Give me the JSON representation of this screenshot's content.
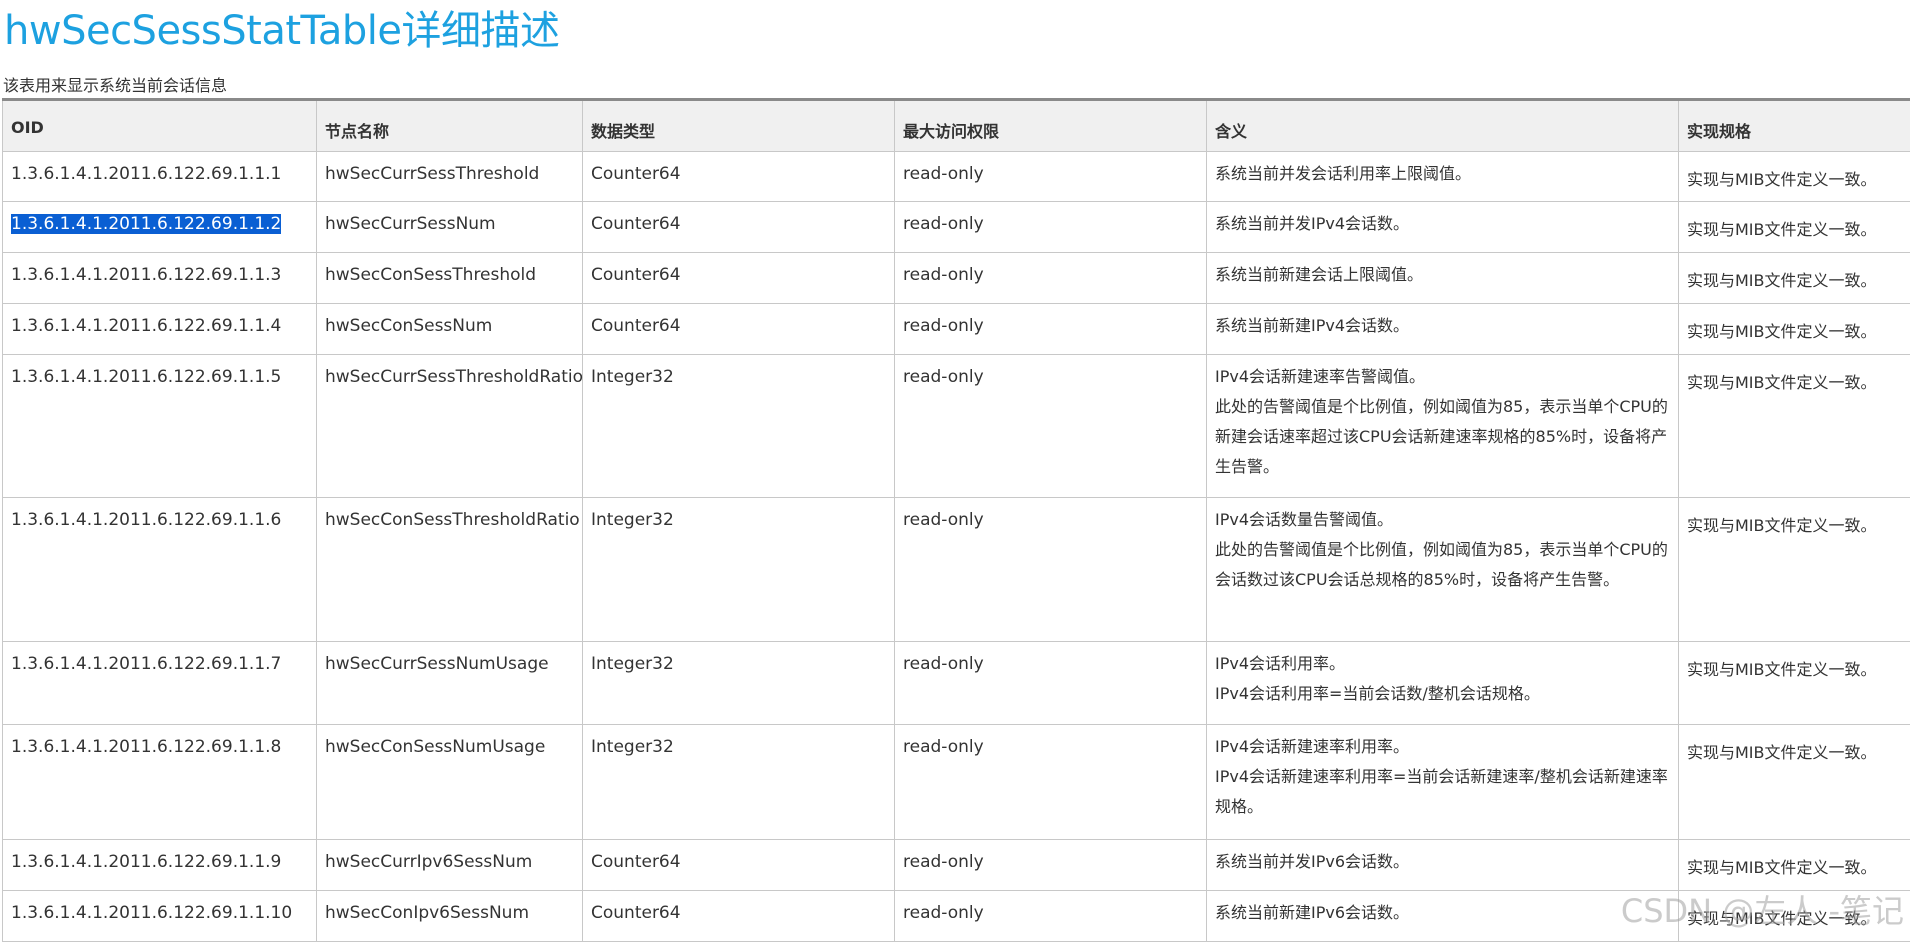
{
  "title": "hwSecSessStatTable详细描述",
  "caption": "该表用来显示系统当前会话信息",
  "columns": [
    "OID",
    "节点名称",
    "数据类型",
    "最大访问权限",
    "含义",
    "实现规格"
  ],
  "rows": [
    {
      "oid": "1.3.6.1.4.1.2011.6.122.69.1.1.1",
      "name": "hwSecCurrSessThreshold",
      "type": "Counter64",
      "access": "read-only",
      "meaning": [
        "系统当前并发会话利用率上限阈值。"
      ],
      "spec": "实现与MIB文件定义一致。",
      "selected": false
    },
    {
      "oid": "1.3.6.1.4.1.2011.6.122.69.1.1.2",
      "name": "hwSecCurrSessNum",
      "type": "Counter64",
      "access": "read-only",
      "meaning": [
        "系统当前并发IPv4会话数。"
      ],
      "spec": "实现与MIB文件定义一致。",
      "selected": true
    },
    {
      "oid": "1.3.6.1.4.1.2011.6.122.69.1.1.3",
      "name": "hwSecConSessThreshold",
      "type": "Counter64",
      "access": "read-only",
      "meaning": [
        "系统当前新建会话上限阈值。"
      ],
      "spec": "实现与MIB文件定义一致。",
      "selected": false
    },
    {
      "oid": "1.3.6.1.4.1.2011.6.122.69.1.1.4",
      "name": "hwSecConSessNum",
      "type": "Counter64",
      "access": "read-only",
      "meaning": [
        "系统当前新建IPv4会话数。"
      ],
      "spec": "实现与MIB文件定义一致。",
      "selected": false
    },
    {
      "oid": "1.3.6.1.4.1.2011.6.122.69.1.1.5",
      "name": "hwSecCurrSessThresholdRatio",
      "type": "Integer32",
      "access": "read-only",
      "meaning": [
        "IPv4会话新建速率告警阈值。",
        "此处的告警阈值是个比例值，例如阈值为85，表示当单个CPU的新建会话速率超过该CPU会话新建速率规格的85%时，设备将产生告警。"
      ],
      "spec": "实现与MIB文件定义一致。",
      "selected": false
    },
    {
      "oid": "1.3.6.1.4.1.2011.6.122.69.1.1.6",
      "name": "hwSecConSessThresholdRatio",
      "type": "Integer32",
      "access": "read-only",
      "meaning": [
        "IPv4会话数量告警阈值。",
        "此处的告警阈值是个比例值，例如阈值为85，表示当单个CPU的会话数过该CPU会话总规格的85%时，设备将产生告警。"
      ],
      "spec": "实现与MIB文件定义一致。",
      "selected": false
    },
    {
      "oid": "1.3.6.1.4.1.2011.6.122.69.1.1.7",
      "name": "hwSecCurrSessNumUsage",
      "type": "Integer32",
      "access": "read-only",
      "meaning": [
        "IPv4会话利用率。",
        "IPv4会话利用率=当前会话数/整机会话规格。"
      ],
      "spec": "实现与MIB文件定义一致。",
      "selected": false
    },
    {
      "oid": "1.3.6.1.4.1.2011.6.122.69.1.1.8",
      "name": "hwSecConSessNumUsage",
      "type": "Integer32",
      "access": "read-only",
      "meaning": [
        "IPv4会话新建速率利用率。",
        "IPv4会话新建速率利用率=当前会话新建速率/整机会话新建速率规格。"
      ],
      "spec": "实现与MIB文件定义一致。",
      "selected": false
    },
    {
      "oid": "1.3.6.1.4.1.2011.6.122.69.1.1.9",
      "name": "hwSecCurrIpv6SessNum",
      "type": "Counter64",
      "access": "read-only",
      "meaning": [
        "系统当前并发IPv6会话数。"
      ],
      "spec": "实现与MIB文件定义一致。",
      "selected": false
    },
    {
      "oid": "1.3.6.1.4.1.2011.6.122.69.1.1.10",
      "name": "hwSecConIpv6SessNum",
      "type": "Counter64",
      "access": "read-only",
      "meaning": [
        "系统当前新建IPv6会话数。"
      ],
      "spec": "实现与MIB文件定义一致。",
      "selected": false
    }
  ],
  "watermark": "CSDN @左人 -笔记"
}
